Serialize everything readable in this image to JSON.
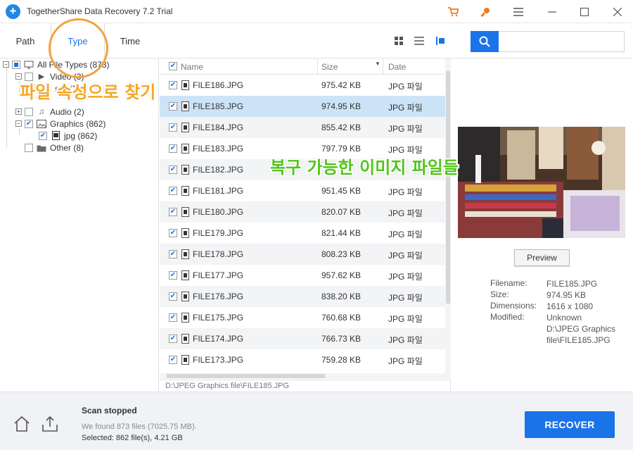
{
  "app": {
    "title": "TogetherShare Data Recovery 7.2 Trial"
  },
  "window_controls": {
    "cart_icon": "cart-icon",
    "key_icon": "key-icon",
    "menu_icon": "hamburger-menu-icon",
    "minimize_icon": "minimize-icon",
    "maximize_icon": "maximize-icon",
    "close_icon": "close-icon"
  },
  "tabs": [
    {
      "label": "Path",
      "active": false
    },
    {
      "label": "Type",
      "active": true
    },
    {
      "label": "Time",
      "active": false
    }
  ],
  "view_modes": [
    "grid-view-icon",
    "list-view-icon",
    "detail-view-icon"
  ],
  "search": {
    "value": "",
    "placeholder": ""
  },
  "tree": {
    "root": "All File Types (873)",
    "items": [
      {
        "label": "Video (3)"
      },
      {
        "label": "swf (3)"
      },
      {
        "label": "Audio (2)"
      },
      {
        "label": "Graphics (862)"
      },
      {
        "label": "jpg (862)"
      },
      {
        "label": "Other (8)"
      }
    ]
  },
  "filelist": {
    "columns": {
      "name": "Name",
      "size": "Size",
      "date": "Date"
    },
    "rows": [
      {
        "name": "FILE186.JPG",
        "size": "975.42 KB",
        "date": "JPG 파일",
        "checked": true
      },
      {
        "name": "FILE185.JPG",
        "size": "974.95 KB",
        "date": "JPG 파일",
        "checked": true
      },
      {
        "name": "FILE184.JPG",
        "size": "855.42 KB",
        "date": "JPG 파일",
        "checked": true
      },
      {
        "name": "FILE183.JPG",
        "size": "797.79 KB",
        "date": "JPG 파일",
        "checked": true
      },
      {
        "name": "FILE182.JPG",
        "size": "",
        "date": "",
        "checked": true
      },
      {
        "name": "FILE181.JPG",
        "size": "951.45 KB",
        "date": "JPG 파일",
        "checked": true
      },
      {
        "name": "FILE180.JPG",
        "size": "820.07 KB",
        "date": "JPG 파일",
        "checked": true
      },
      {
        "name": "FILE179.JPG",
        "size": "821.44 KB",
        "date": "JPG 파일",
        "checked": true
      },
      {
        "name": "FILE178.JPG",
        "size": "808.23 KB",
        "date": "JPG 파일",
        "checked": true
      },
      {
        "name": "FILE177.JPG",
        "size": "957.62 KB",
        "date": "JPG 파일",
        "checked": true
      },
      {
        "name": "FILE176.JPG",
        "size": "838.20 KB",
        "date": "JPG 파일",
        "checked": true
      },
      {
        "name": "FILE175.JPG",
        "size": "760.68 KB",
        "date": "JPG 파일",
        "checked": true
      },
      {
        "name": "FILE174.JPG",
        "size": "766.73 KB",
        "date": "JPG 파일",
        "checked": true
      },
      {
        "name": "FILE173.JPG",
        "size": "759.28 KB",
        "date": "JPG 파일",
        "checked": true
      }
    ],
    "path": "D:\\JPEG Graphics file\\FILE185.JPG"
  },
  "preview": {
    "button": "Preview",
    "meta": [
      {
        "key": "Filename:",
        "value": "FILE185.JPG"
      },
      {
        "key": "Size:",
        "value": "974.95 KB"
      },
      {
        "key": "Dimensions:",
        "value": "1616 x 1080"
      },
      {
        "key": "Modified:",
        "value": "Unknown"
      },
      {
        "key": "",
        "value": "D:\\JPEG Graphics file\\FILE185.JPG"
      }
    ]
  },
  "footer": {
    "title": "Scan stopped",
    "line1": "We found 873 files (7025.75 MB).",
    "line2": "Selected: 862 file(s), 4.21 GB",
    "recover": "RECOVER"
  },
  "annotations": {
    "orange": "파일 속성으로 찾기",
    "green": "복구 가능한 이미지 파일들"
  },
  "colors": {
    "accent": "#1a73e8",
    "annotation_orange": "#f5a623",
    "annotation_green": "#52c41a",
    "selected_row": "#cde3f7"
  }
}
